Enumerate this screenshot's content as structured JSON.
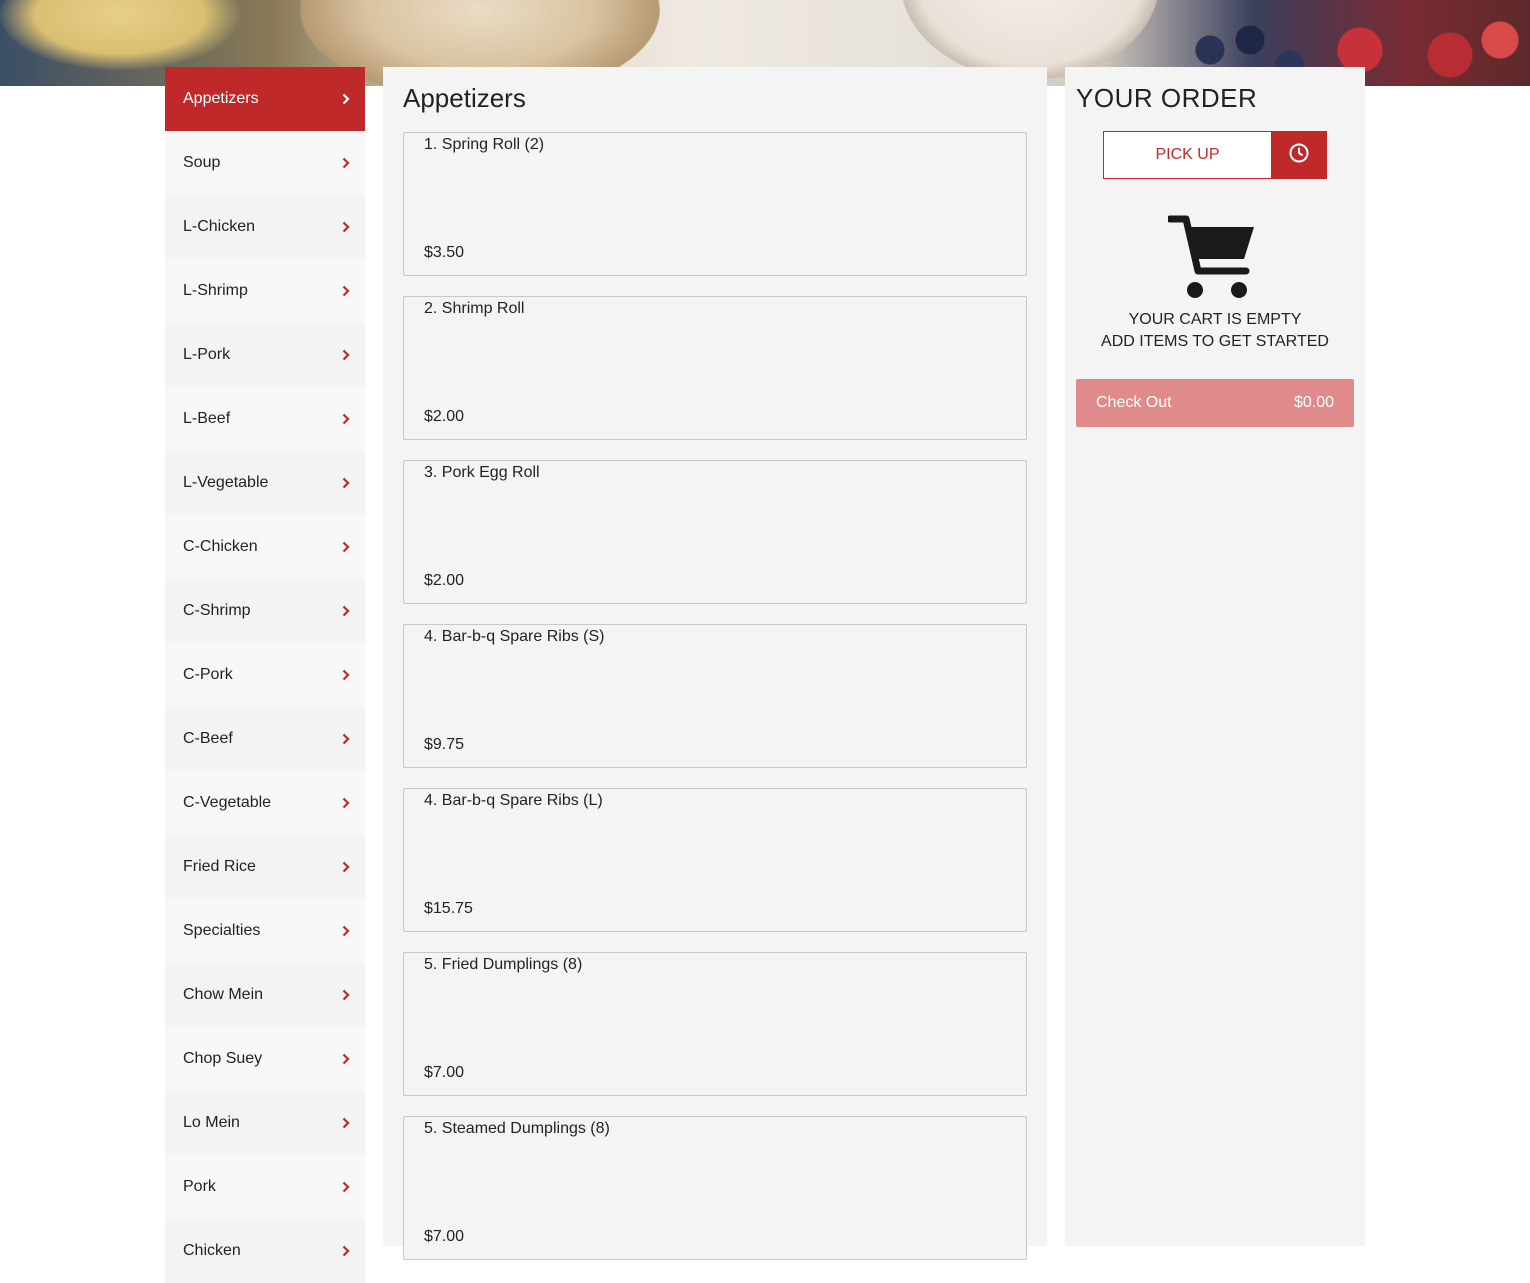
{
  "sidebar": {
    "items": [
      {
        "label": "Appetizers"
      },
      {
        "label": "Soup"
      },
      {
        "label": "L-Chicken"
      },
      {
        "label": "L-Shrimp"
      },
      {
        "label": "L-Pork"
      },
      {
        "label": "L-Beef"
      },
      {
        "label": "L-Vegetable"
      },
      {
        "label": "C-Chicken"
      },
      {
        "label": "C-Shrimp"
      },
      {
        "label": "C-Pork"
      },
      {
        "label": "C-Beef"
      },
      {
        "label": "C-Vegetable"
      },
      {
        "label": "Fried Rice"
      },
      {
        "label": "Specialties"
      },
      {
        "label": "Chow Mein"
      },
      {
        "label": "Chop Suey"
      },
      {
        "label": "Lo Mein"
      },
      {
        "label": "Pork"
      },
      {
        "label": "Chicken"
      }
    ],
    "active_index": 0,
    "chevron_icon": "chevron-right-icon"
  },
  "main": {
    "section_title": "Appetizers",
    "items": [
      {
        "name": "1. Spring Roll (2)",
        "price": "$3.50"
      },
      {
        "name": "2. Shrimp Roll",
        "price": "$2.00"
      },
      {
        "name": "3. Pork Egg Roll",
        "price": "$2.00"
      },
      {
        "name": "4. Bar-b-q Spare Ribs (S)",
        "price": "$9.75"
      },
      {
        "name": "4. Bar-b-q Spare Ribs (L)",
        "price": "$15.75"
      },
      {
        "name": "5. Fried Dumplings (8)",
        "price": "$7.00"
      },
      {
        "name": "5. Steamed Dumplings (8)",
        "price": "$7.00"
      }
    ]
  },
  "order": {
    "title": "YOUR ORDER",
    "pickup_label": "PICK UP",
    "pickup_time_icon": "clock-icon",
    "cart_icon": "shopping-cart-icon",
    "empty_line1": "YOUR CART IS EMPTY",
    "empty_line2": "ADD ITEMS TO GET STARTED",
    "checkout_label": "Check Out",
    "checkout_total": "$0.00"
  },
  "colors": {
    "accent": "#c0292a",
    "checkout_disabled": "#e08b8b",
    "panel_bg": "#f4f4f4"
  }
}
